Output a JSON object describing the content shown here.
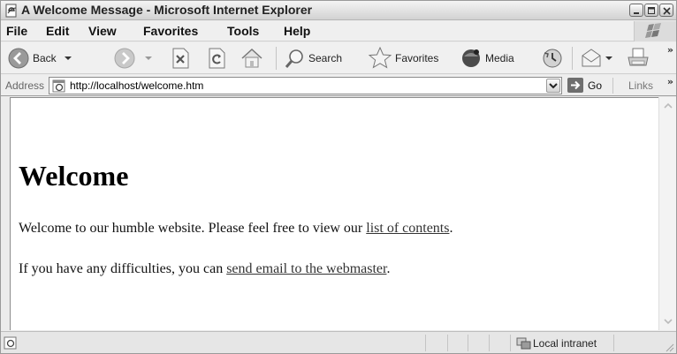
{
  "window": {
    "title": "A Welcome Message - Microsoft Internet Explorer"
  },
  "menu": {
    "items": [
      {
        "label": "File"
      },
      {
        "label": "Edit"
      },
      {
        "label": "View"
      },
      {
        "label": "Favorites"
      },
      {
        "label": "Tools"
      },
      {
        "label": "Help"
      }
    ]
  },
  "toolbar": {
    "back_label": "Back",
    "search_label": "Search",
    "favorites_label": "Favorites",
    "media_label": "Media"
  },
  "address": {
    "label": "Address",
    "url": "http://localhost/welcome.htm",
    "go_label": "Go",
    "links_label": "Links"
  },
  "page": {
    "heading": "Welcome",
    "para1_text": "Welcome to our humble website. Please feel free to view our ",
    "para1_link": "list of contents",
    "para1_end": ".",
    "para2_text": "If you have any difficulties, you can ",
    "para2_link": "send email to the webmaster",
    "para2_end": "."
  },
  "status": {
    "zone": "Local intranet"
  }
}
